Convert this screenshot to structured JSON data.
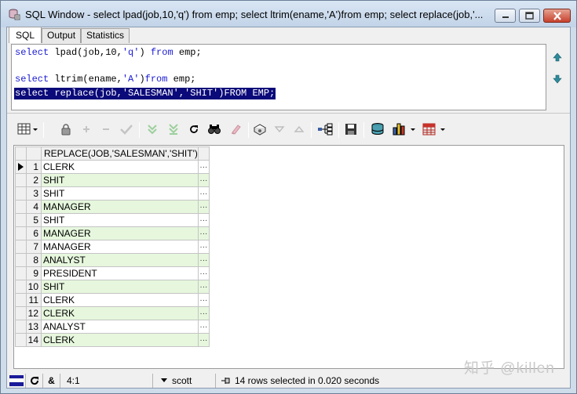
{
  "window": {
    "title": "SQL Window - select lpad(job,10,'q') from emp; select ltrim(ename,'A')from emp; select replace(job,'..."
  },
  "tabs": [
    {
      "label": "SQL",
      "active": true
    },
    {
      "label": "Output",
      "active": false
    },
    {
      "label": "Statistics",
      "active": false
    }
  ],
  "editor": {
    "line1": {
      "k1": "select",
      "t1": " lpad(job,10,",
      "s1": "'q'",
      "t2": ") ",
      "k2": "from",
      "t3": " emp;"
    },
    "line2": {
      "k1": "select",
      "t1": " ltrim(ename,",
      "s1": "'A'",
      "t2": ")",
      "k2": "from",
      "t3": " emp;"
    },
    "line3": "select replace(job,'SALESMAN','SHIT')FROM EMP;"
  },
  "toolbar": {
    "icons": [
      "grid-mode-icon",
      "lock-icon",
      "add-record-icon",
      "delete-record-icon",
      "post-changes-icon",
      "fetch-next-icon",
      "fetch-last-icon",
      "refresh-icon",
      "find-icon",
      "clear-icon",
      "query-by-example-icon",
      "previous-icon",
      "next-icon",
      "export-tree-icon",
      "save-icon",
      "single-record-icon",
      "chart-icon",
      "table-export-icon"
    ]
  },
  "grid": {
    "column_header": "REPLACE(JOB,'SALESMAN','SHIT')",
    "rows": [
      {
        "n": "1",
        "value": "CLERK"
      },
      {
        "n": "2",
        "value": "SHIT"
      },
      {
        "n": "3",
        "value": "SHIT"
      },
      {
        "n": "4",
        "value": "MANAGER"
      },
      {
        "n": "5",
        "value": "SHIT"
      },
      {
        "n": "6",
        "value": "MANAGER"
      },
      {
        "n": "7",
        "value": "MANAGER"
      },
      {
        "n": "8",
        "value": "ANALYST"
      },
      {
        "n": "9",
        "value": "PRESIDENT"
      },
      {
        "n": "10",
        "value": "SHIT"
      },
      {
        "n": "11",
        "value": "CLERK"
      },
      {
        "n": "12",
        "value": "CLERK"
      },
      {
        "n": "13",
        "value": "ANALYST"
      },
      {
        "n": "14",
        "value": "CLERK"
      }
    ],
    "cell_button": "···",
    "alt_row_color": "#e6f7dd"
  },
  "statusbar": {
    "amp": "&",
    "position": "4:1",
    "user": "scott",
    "message": "14 rows selected in 0.020 seconds"
  },
  "watermark": "知乎 @killen"
}
